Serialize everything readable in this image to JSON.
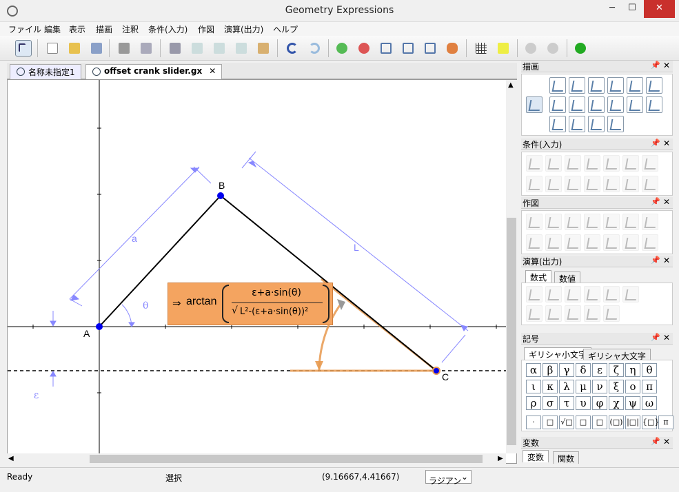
{
  "window": {
    "title": "Geometry Expressions"
  },
  "menu": [
    "ファイル",
    "編集",
    "表示",
    "描画",
    "注釈",
    "条件(入力)",
    "作図",
    "演算(出力)",
    "ヘルプ"
  ],
  "tabs": [
    {
      "label": "名称未指定1"
    },
    {
      "label": "offset crank slider.gx"
    }
  ],
  "canvas": {
    "labels": {
      "A": "A",
      "B": "B",
      "C": "C",
      "a": "a",
      "L": "L",
      "theta": "θ",
      "epsilon": "ε"
    },
    "expression": {
      "prefix": "⇒",
      "fn": "arctan",
      "numerator": "ε+a·sin(θ)",
      "denominator_prefix": "√",
      "denominator": "L²-(ε+a·sin(θ))²"
    }
  },
  "panels": {
    "draw": {
      "title": "描画"
    },
    "constrain": {
      "title": "条件(入力)"
    },
    "construct": {
      "title": "作図"
    },
    "calculate": {
      "title": "演算(出力)",
      "tabs": [
        "数式",
        "数値"
      ]
    },
    "symbols": {
      "title": "記号",
      "tabs": [
        "ギリシャ小文字",
        "ギリシャ大文字"
      ],
      "greek": [
        "α",
        "β",
        "γ",
        "δ",
        "ε",
        "ζ",
        "η",
        "θ",
        "ι",
        "κ",
        "λ",
        "μ",
        "ν",
        "ξ",
        "ο",
        "π",
        "ρ",
        "σ",
        "τ",
        "υ",
        "φ",
        "χ",
        "ψ",
        "ω"
      ],
      "bottom_symbols": [
        "·",
        "□",
        "√□",
        "□",
        "□",
        "(□)",
        "|□|",
        "{□}",
        "π"
      ]
    },
    "variables": {
      "title": "変数",
      "tabs": [
        "変数",
        "関数"
      ]
    }
  },
  "status": {
    "ready": "Ready",
    "mode": "選択",
    "coords": "(9.16667,4.41667)",
    "angle_mode": "ラジアン"
  },
  "colors": {
    "accent": "#f4a460",
    "construction": "#8888ff",
    "point": "#0000ee"
  }
}
